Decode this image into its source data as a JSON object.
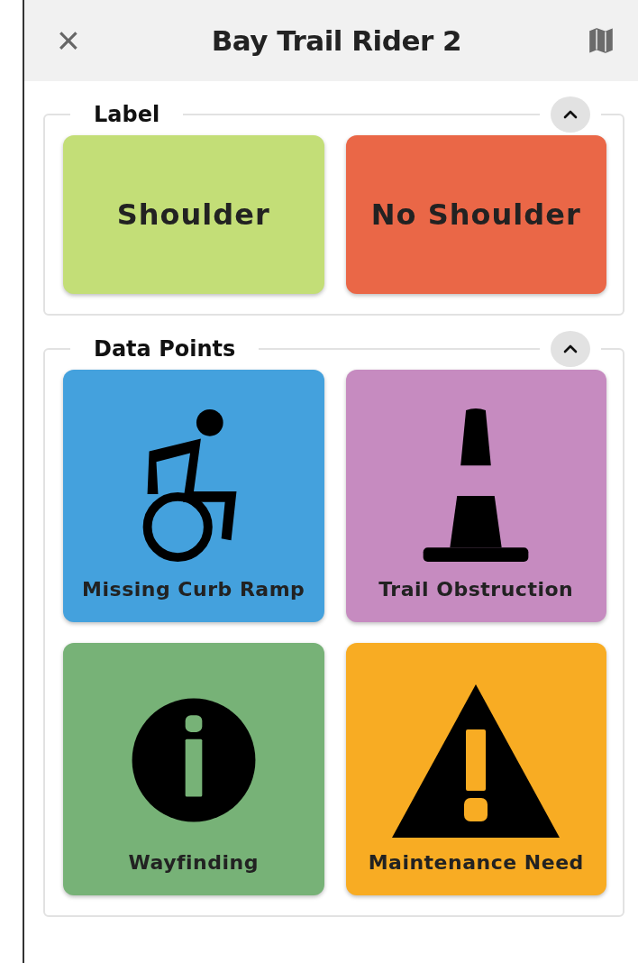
{
  "header": {
    "close": "×",
    "title": "Bay Trail Rider 2"
  },
  "sections": [
    {
      "title": "Label",
      "expanded": true,
      "items": [
        {
          "label": "Shoulder",
          "color": "#c3de77",
          "kind": "text"
        },
        {
          "label": "No Shoulder",
          "color": "#ea6747",
          "kind": "text"
        }
      ]
    },
    {
      "title": "Data Points",
      "expanded": true,
      "items": [
        {
          "label": "Missing Curb Ramp",
          "color": "#44a1dd",
          "kind": "wheelchair"
        },
        {
          "label": "Trail Obstruction",
          "color": "#c68bc0",
          "kind": "cone"
        },
        {
          "label": "Wayfinding",
          "color": "#77b277",
          "kind": "info"
        },
        {
          "label": "Maintenance Need",
          "color": "#f8ac23",
          "kind": "warning"
        }
      ]
    }
  ]
}
